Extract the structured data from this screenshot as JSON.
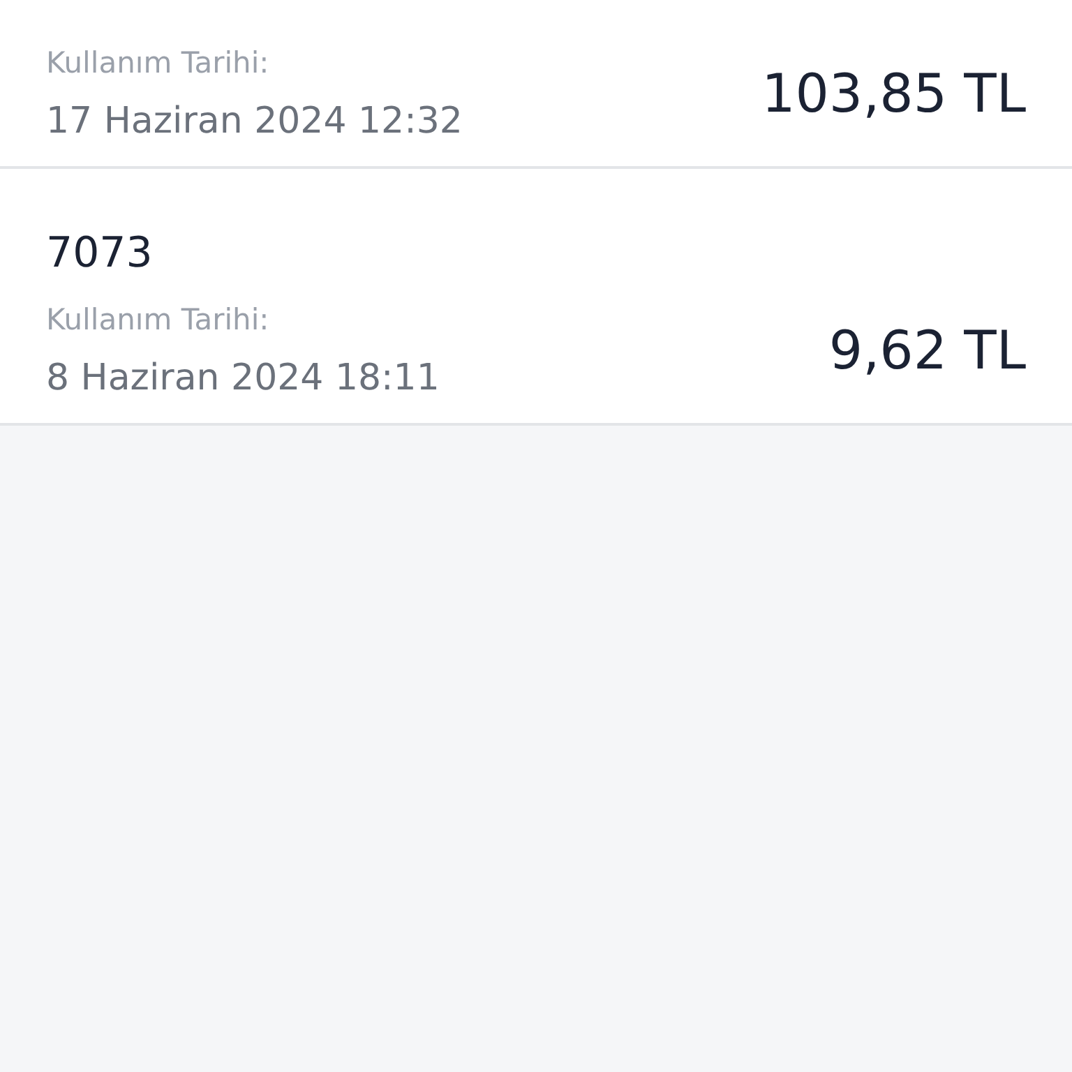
{
  "transactions": [
    {
      "label": "Kullanım Tarihi:",
      "date": "17 Haziran 2024 12:32",
      "amount": "103,85 TL"
    },
    {
      "code": "7073",
      "label": "Kullanım Tarihi:",
      "date": "8 Haziran 2024 18:11",
      "amount": "9,62 TL"
    }
  ]
}
